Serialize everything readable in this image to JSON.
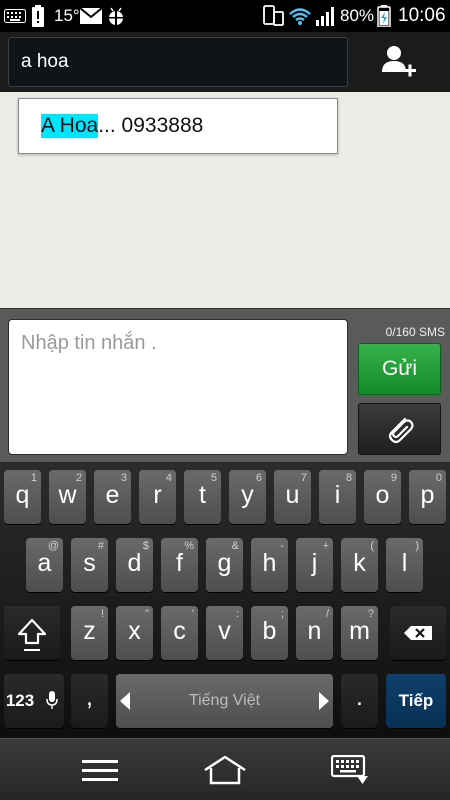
{
  "status_bar": {
    "temperature": "15°",
    "battery": "80%",
    "time": "10:06",
    "icons": [
      "keyboard-icon",
      "battery-alert-icon",
      "mail-icon",
      "android-debug-icon",
      "phone-screen-icon",
      "wifi-icon",
      "signal-icon",
      "battery-charging-icon"
    ]
  },
  "recipient": {
    "value": "a hoa",
    "add_contact_icon": "add-person-icon"
  },
  "suggestion": {
    "highlight": "A Hoa",
    "rest": "... 0933888"
  },
  "compose": {
    "placeholder": "Nhập tin nhắn .",
    "counter": "0/160 SMS",
    "send_label": "Gửi",
    "attach_icon": "paperclip-icon"
  },
  "keyboard": {
    "row1": [
      {
        "key": "q",
        "sub": "1"
      },
      {
        "key": "w",
        "sub": "2"
      },
      {
        "key": "e",
        "sub": "3"
      },
      {
        "key": "r",
        "sub": "4"
      },
      {
        "key": "t",
        "sub": "5"
      },
      {
        "key": "y",
        "sub": "6"
      },
      {
        "key": "u",
        "sub": "7"
      },
      {
        "key": "i",
        "sub": "8"
      },
      {
        "key": "o",
        "sub": "9"
      },
      {
        "key": "p",
        "sub": "0"
      }
    ],
    "row2": [
      {
        "key": "a",
        "sub": "@"
      },
      {
        "key": "s",
        "sub": "#"
      },
      {
        "key": "d",
        "sub": "$"
      },
      {
        "key": "f",
        "sub": "%"
      },
      {
        "key": "g",
        "sub": "&"
      },
      {
        "key": "h",
        "sub": "-"
      },
      {
        "key": "j",
        "sub": "+"
      },
      {
        "key": "k",
        "sub": "("
      },
      {
        "key": "l",
        "sub": ")"
      }
    ],
    "row3": [
      {
        "key": "z",
        "sub": "!"
      },
      {
        "key": "x",
        "sub": "\""
      },
      {
        "key": "c",
        "sub": "'"
      },
      {
        "key": "v",
        "sub": ":"
      },
      {
        "key": "b",
        "sub": ";"
      },
      {
        "key": "n",
        "sub": "/"
      },
      {
        "key": "m",
        "sub": "?"
      }
    ],
    "shift_icon": "shift-icon",
    "backspace_icon": "backspace-icon",
    "numbers_label": "123",
    "mic_icon": "microphone-icon",
    "comma": ",",
    "language": "Tiếng Việt",
    "period": ".",
    "action_label": "Tiếp"
  },
  "nav_bar": {
    "icons": [
      "menu-icon",
      "home-icon",
      "keyboard-hide-icon"
    ]
  }
}
